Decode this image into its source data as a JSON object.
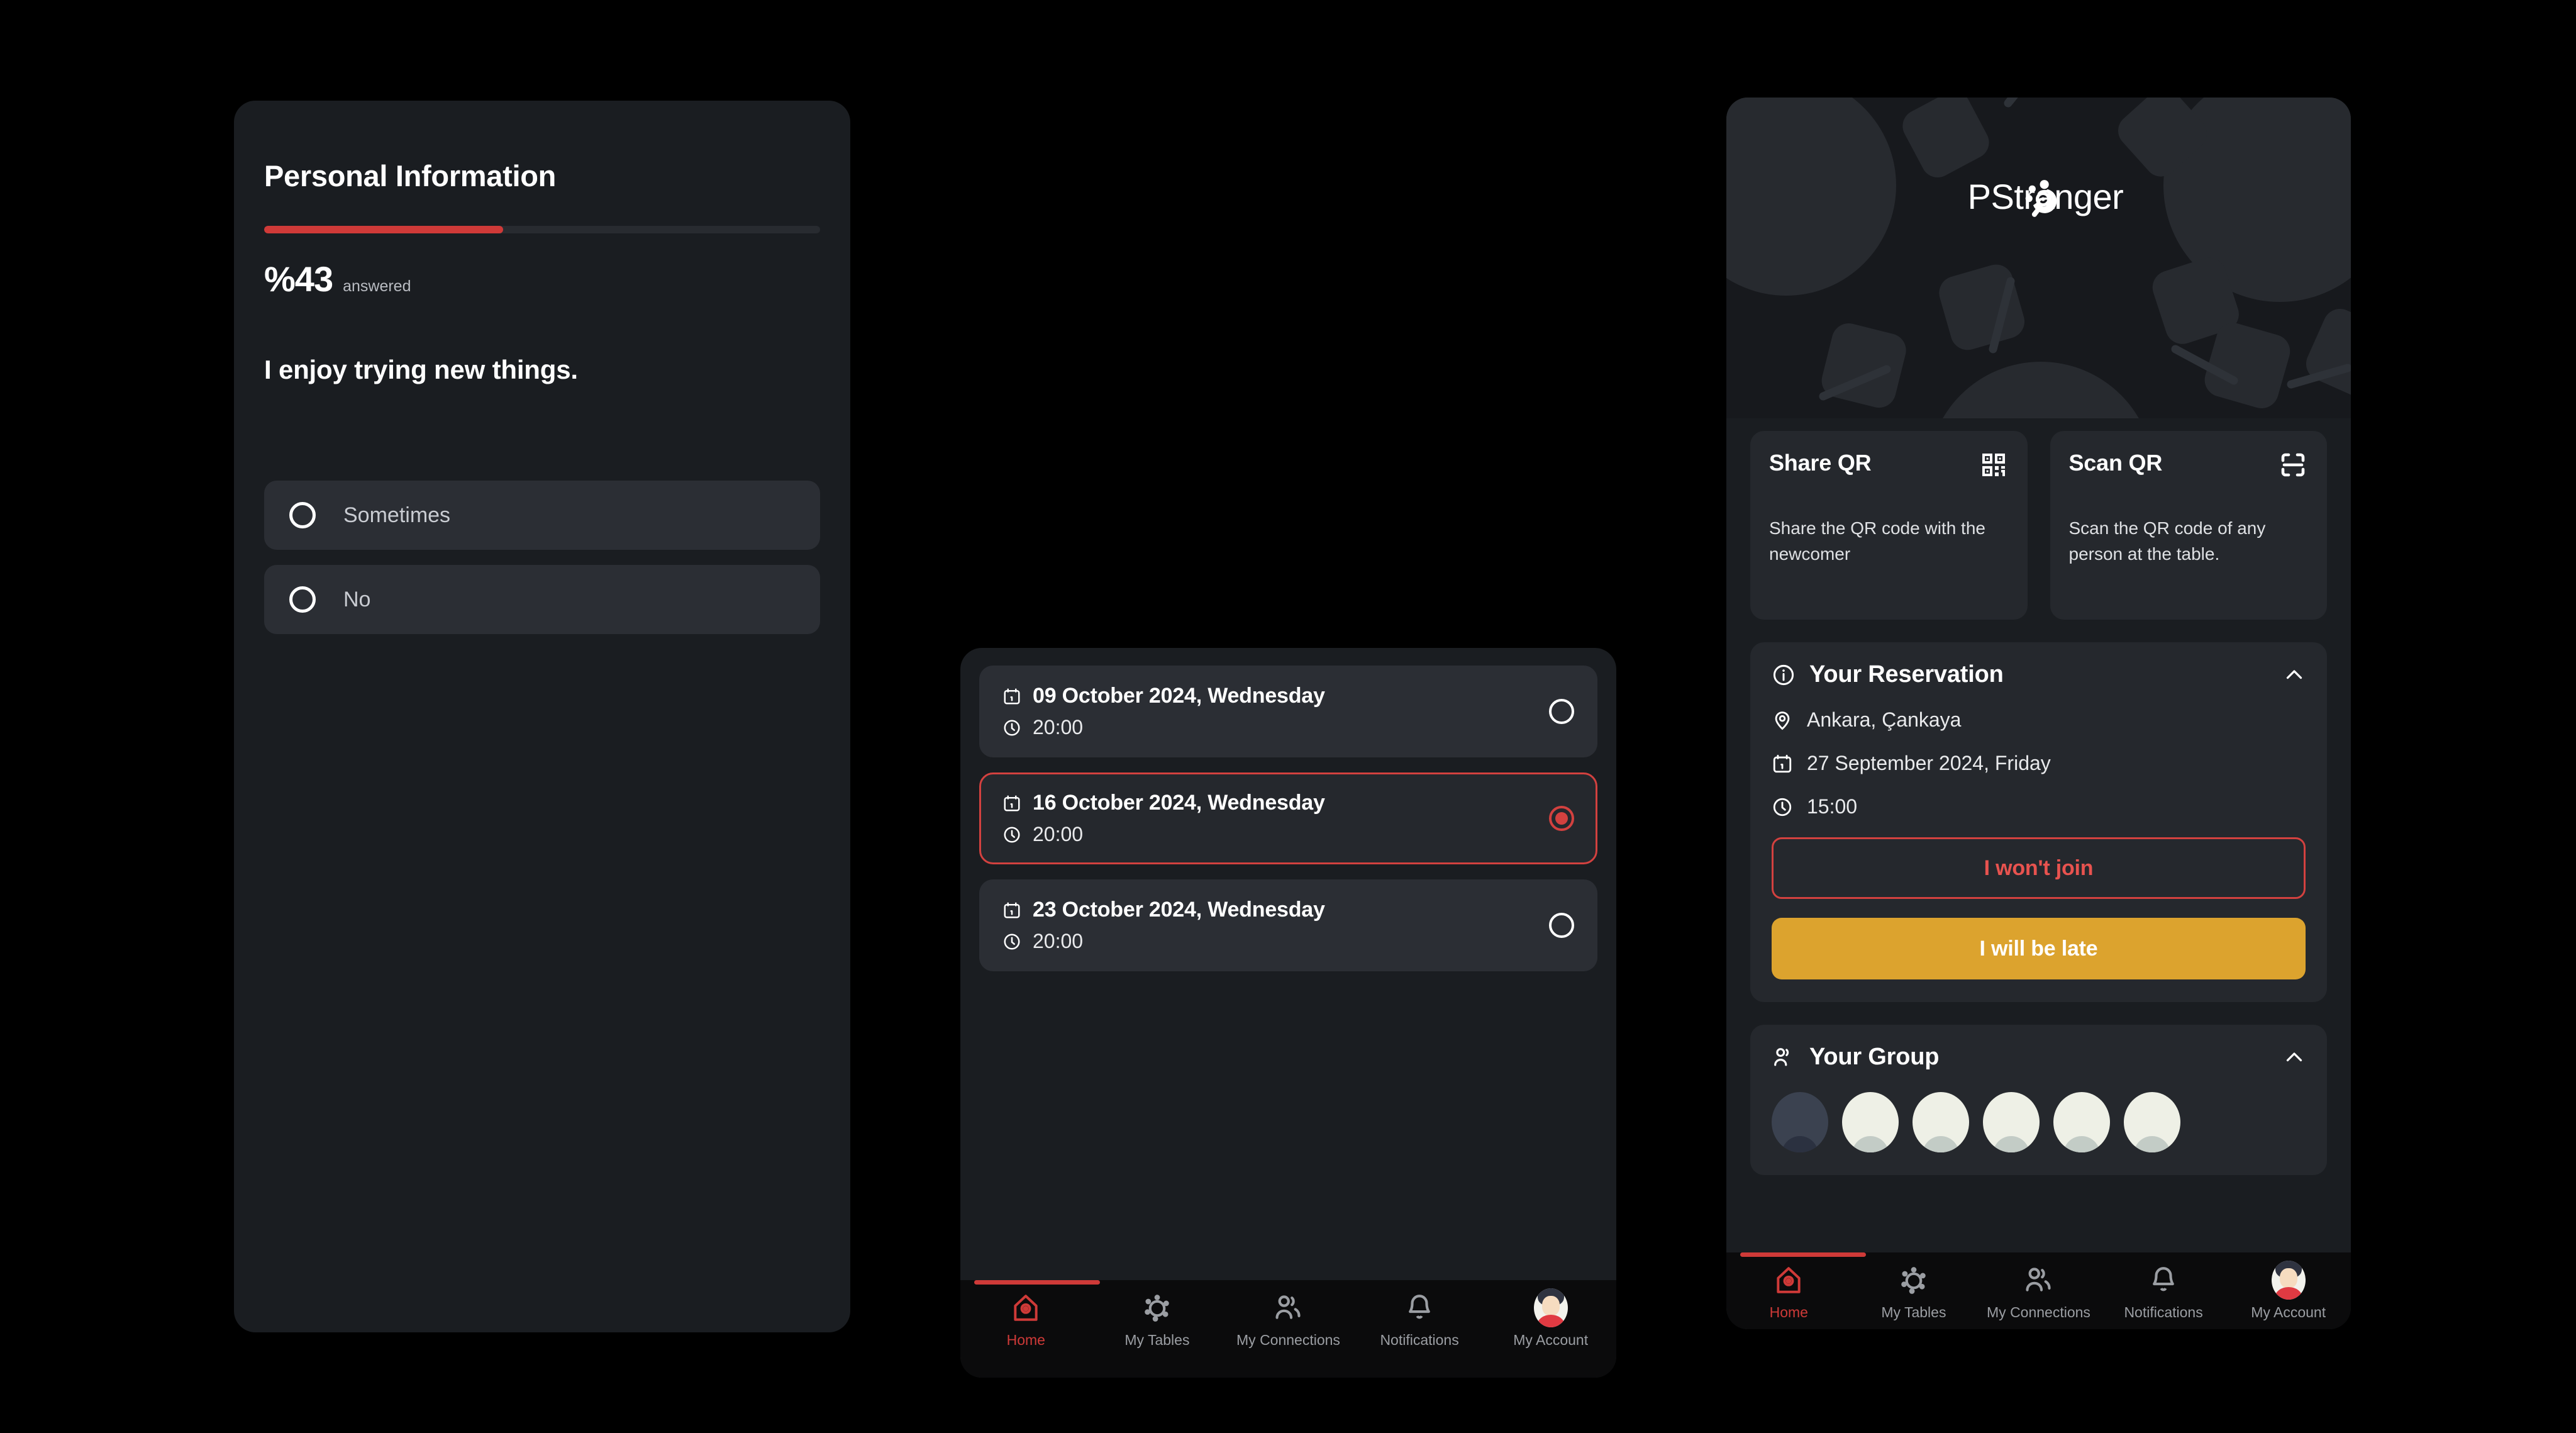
{
  "survey": {
    "title": "Personal Information",
    "progress_percent": 43,
    "answered_value": "%43",
    "answered_label": "answered",
    "question": "I enjoy trying new things.",
    "options": [
      {
        "label": "Sometimes",
        "selected": false
      },
      {
        "label": "No",
        "selected": false
      }
    ],
    "accent_color": "#cf3a38"
  },
  "tables": {
    "dates": [
      {
        "date": "09 October 2024, Wednesday",
        "time": "20:00",
        "selected": false
      },
      {
        "date": "16 October 2024, Wednesday",
        "time": "20:00",
        "selected": true
      },
      {
        "date": "23 October 2024, Wednesday",
        "time": "20:00",
        "selected": false
      }
    ]
  },
  "nav": {
    "items": [
      {
        "label": "Home",
        "icon": "home-pin-icon",
        "active": true
      },
      {
        "label": "My Tables",
        "icon": "table-seats-icon",
        "active": false
      },
      {
        "label": "My Connections",
        "icon": "people-icon",
        "active": false
      },
      {
        "label": "Notifications",
        "icon": "bell-icon",
        "active": false
      },
      {
        "label": "My Account",
        "icon": "avatar-icon",
        "active": false
      }
    ],
    "active_color": "#cf3a38",
    "inactive_color": "#9b9ea3"
  },
  "home": {
    "brand": "PStranger",
    "qr_cards": [
      {
        "title": "Share QR",
        "description": "Share the QR code with the newcomer",
        "icon": "qr-code-icon"
      },
      {
        "title": "Scan QR",
        "description": "Scan the QR code of any person at the table.",
        "icon": "qr-scan-icon"
      }
    ],
    "reservation": {
      "title": "Your Reservation",
      "icon": "info-icon",
      "collapse_icon": "chevron-up-icon",
      "location": "Ankara, Çankaya",
      "date": "27 September 2024, Friday",
      "time": "15:00",
      "decline_label": "I won't join",
      "late_label": "I will be late",
      "decline_color": "#e8534f",
      "late_color": "#dca32e"
    },
    "group": {
      "title": "Your Group",
      "icon": "people-icon",
      "collapse_icon": "chevron-up-icon",
      "member_count": 6
    }
  }
}
